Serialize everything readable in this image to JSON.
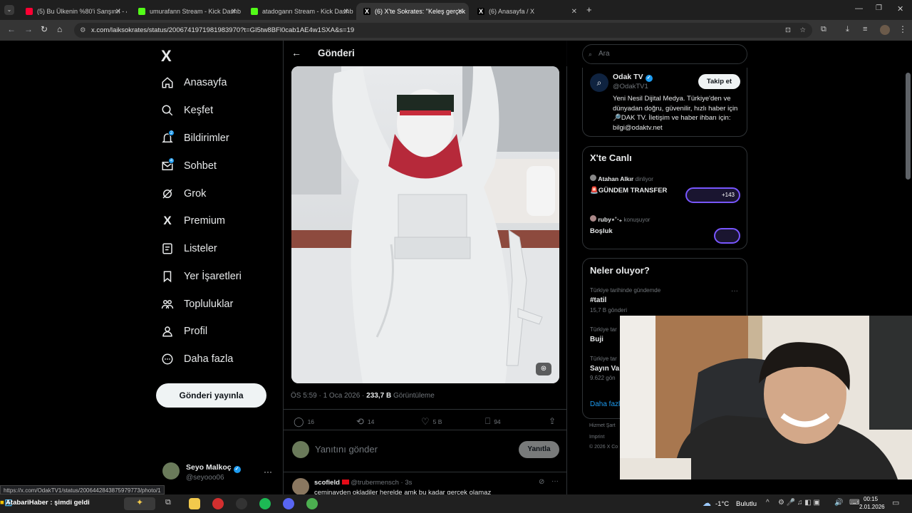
{
  "browser": {
    "tabs": [
      {
        "label": "(5) Bu Ülkenin %80'i Sanşını! - 4",
        "favicon_color": "#ff0033"
      },
      {
        "label": "umurafann Stream - Kick Dashb",
        "favicon_color": "#53fc18"
      },
      {
        "label": "atadogann Stream - Kick Dashb",
        "favicon_color": "#53fc18"
      },
      {
        "label": "(6) X'te Sokrates: \"Keleş gerçek",
        "favicon_color": "#ffffff"
      },
      {
        "label": "(6) Anasayfa / X",
        "favicon_color": "#ffffff"
      }
    ],
    "url": "x.com/laiksokrates/status/2006741971981983970?t=GI5tw8BFl0cab1AE4w1SXA&s=19",
    "status_url": "https://x.com/OdakTV1/status/2006442843875979773/photo/1"
  },
  "sidebar": {
    "logo": "X",
    "items": [
      {
        "label": "Anasayfa",
        "icon": "home-icon"
      },
      {
        "label": "Keşfet",
        "icon": "search-icon"
      },
      {
        "label": "Bildirimler",
        "icon": "bell-icon",
        "badge": "2"
      },
      {
        "label": "Sohbet",
        "icon": "mail-icon",
        "badge": "4"
      },
      {
        "label": "Grok",
        "icon": "grok-icon"
      },
      {
        "label": "Premium",
        "icon": "x-premium-icon"
      },
      {
        "label": "Listeler",
        "icon": "list-icon"
      },
      {
        "label": "Yer İşaretleri",
        "icon": "bookmark-icon"
      },
      {
        "label": "Topluluklar",
        "icon": "communities-icon"
      },
      {
        "label": "Profil",
        "icon": "profile-icon"
      },
      {
        "label": "Daha fazla",
        "icon": "more-circle-icon"
      }
    ],
    "post_button": "Gönderi yayınla",
    "user": {
      "name": "Seyo Malkoç",
      "handle": "@seyooo06"
    }
  },
  "main": {
    "header_title": "Gönderi",
    "meta": {
      "time": "ÖS 5:59 · 1 Oca 2026 · ",
      "views": "233,7 B",
      "views_label": " Görüntüleme"
    },
    "actions": {
      "replies": "16",
      "reposts": "14",
      "likes": "5 B",
      "bookmarks": "94"
    },
    "reply_placeholder": "Yanıtını gönder",
    "reply_button": "Yanıtla",
    "reply": {
      "name": "scofield",
      "handle": "@trubermensch · 3s",
      "text": "ceminayden okladiler herelde amk bu kadar gercek olamaz"
    }
  },
  "right": {
    "search_placeholder": "Ara",
    "profile_card": {
      "name": "Odak TV",
      "handle": "@OdakTV1",
      "follow": "Takip et",
      "bio": "Yeni Nesil Dijital Medya. Türkiye'den ve dünyadan doğru, güvenilir, hızlı haber için 🔎DAK TV. İletişim ve haber ihbarı için: bilgi@odaktv.net"
    },
    "live": {
      "title": "X'te Canlı",
      "items": [
        {
          "host": "Atahan Alkır",
          "status": "dinliyor",
          "title": "🚨GÜNDEM TRANSFER",
          "count": "+143"
        },
        {
          "host": "ruby⋆˚‧₊",
          "status": "konuşuyor",
          "title": "Boşluk",
          "count": ""
        }
      ]
    },
    "trends": {
      "title": "Neler oluyor?",
      "items": [
        {
          "context": "Türkiye tarihinde gündemde",
          "name": "#tatil",
          "count": "15,7 B gönderi"
        },
        {
          "context": "Türkiye tar",
          "name": "Buji",
          "count": ""
        },
        {
          "context": "Türkiye tar",
          "name": "Sayın Va",
          "count": "9.622 gön"
        }
      ],
      "more": "Daha fazl"
    },
    "footer": [
      "Hizmet Şart",
      "Imprint",
      "© 2026 X Co"
    ]
  },
  "taskbar": {
    "news": "AtabariHaber : şimdi geldi",
    "weather": "-1°C",
    "weather_desc": "Bulutlu",
    "time": "00:15",
    "date": "2.01.2026"
  }
}
